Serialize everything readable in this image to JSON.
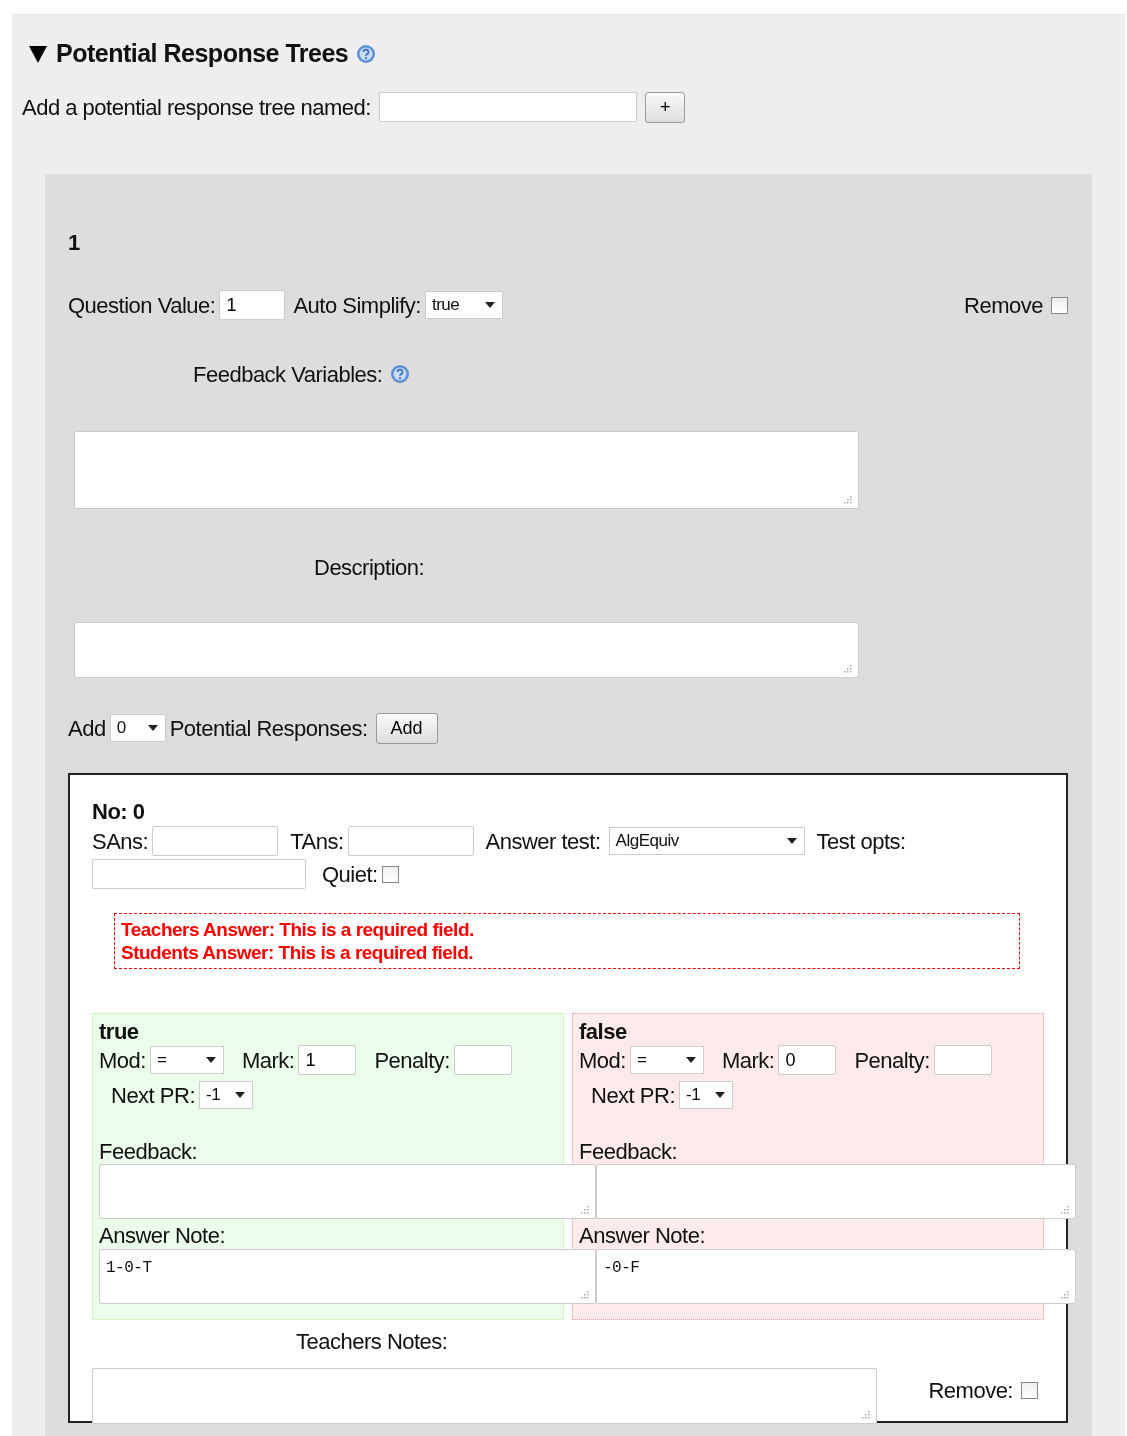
{
  "section": {
    "title": "Potential Response Trees",
    "expanded": true,
    "add_label": "Add a potential response tree named:",
    "add_button": "+"
  },
  "tree": {
    "name": "1",
    "question_value_label": "Question Value:",
    "question_value": "1",
    "auto_simplify_label": "Auto Simplify:",
    "auto_simplify": "true",
    "remove_label": "Remove",
    "remove_checked": false,
    "feedback_variables_label": "Feedback Variables:",
    "description_label": "Description:",
    "add_label": "Add",
    "add_count": "0",
    "add_suffix": "Potential Responses:",
    "add_button": "Add",
    "node": {
      "title": "No: 0",
      "sans_label": "SAns:",
      "tans_label": "TAns:",
      "answer_test_label": "Answer test:",
      "answer_test": "AlgEquiv",
      "test_opts_label": "Test opts:",
      "quiet_label": "Quiet:",
      "quiet_checked": false,
      "errors": [
        "Teachers Answer: This is a required field.",
        "Students Answer: This is a required field."
      ],
      "branches": [
        {
          "kind": "true",
          "title": "true",
          "mod_label": "Mod:",
          "mod": "=",
          "mark_label": "Mark:",
          "mark": "1",
          "penalty_label": "Penalty:",
          "next_label": "Next PR:",
          "next": "-1",
          "feedback_label": "Feedback:",
          "note_label": "Answer Note:",
          "note": "1-0-T"
        },
        {
          "kind": "false",
          "title": "false",
          "mod_label": "Mod:",
          "mod": "=",
          "mark_label": "Mark:",
          "mark": "0",
          "penalty_label": "Penalty:",
          "next_label": "Next PR:",
          "next": "-1",
          "feedback_label": "Feedback:",
          "note_label": "Answer Note:",
          "note": "-0-F"
        }
      ],
      "teachers_notes_label": "Teachers Notes:",
      "remove_label": "Remove:",
      "remove_checked": false
    }
  }
}
